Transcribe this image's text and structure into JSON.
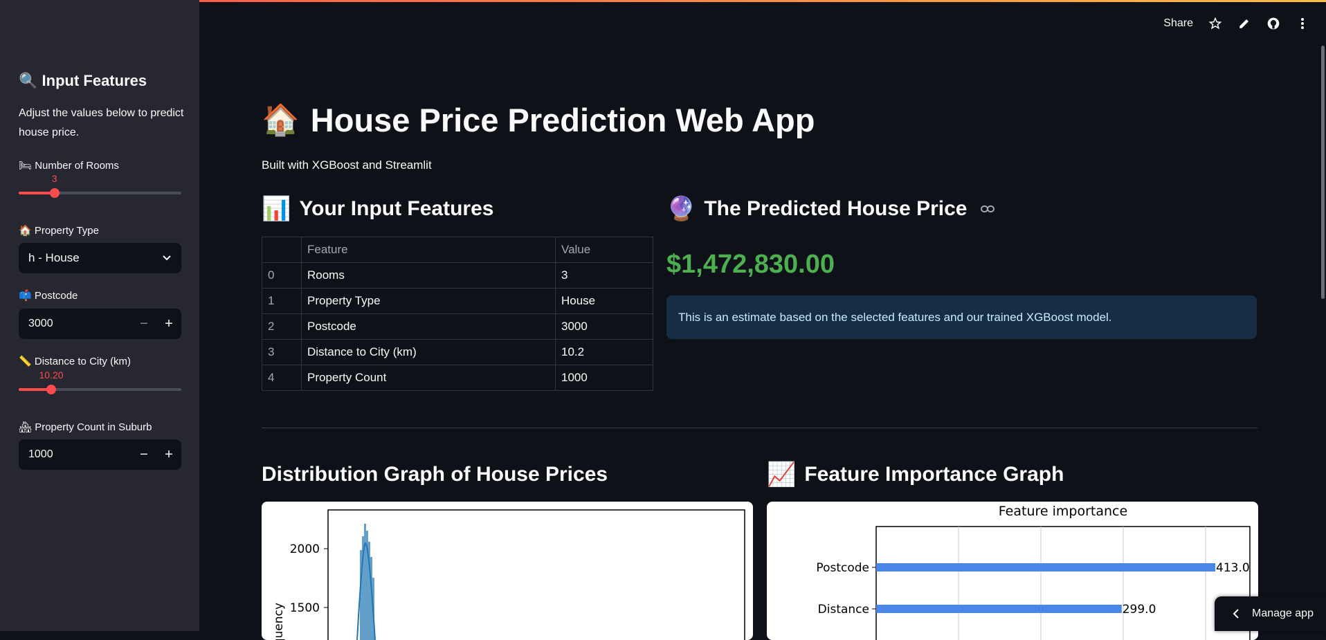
{
  "toolbar": {
    "share_label": "Share",
    "icons": [
      "star-icon",
      "edit-icon",
      "github-icon",
      "more-icon"
    ]
  },
  "sidebar": {
    "title": "Input Features",
    "title_icon": "magnifier-icon",
    "description": "Adjust the values below to predict house price.",
    "rooms": {
      "label": "Number of Rooms",
      "icon": "bed-icon",
      "value": "3",
      "fraction": 0.22
    },
    "property_type": {
      "label": "Property Type",
      "icon": "house-icon",
      "value": "h - House"
    },
    "postcode": {
      "label": "Postcode",
      "icon": "mailbox-icon",
      "value": "3000",
      "minus": "−",
      "plus": "+"
    },
    "distance": {
      "label": "Distance to City (km)",
      "icon": "ruler-icon",
      "value": "10.20",
      "fraction": 0.2
    },
    "property_count": {
      "label": "Property Count in Suburb",
      "icon": "houses-icon",
      "value": "1000",
      "minus": "−",
      "plus": "+"
    }
  },
  "main": {
    "title": "House Price Prediction Web App",
    "subtitle": "Built with XGBoost and Streamlit",
    "input_heading": "Your Input Features",
    "table": {
      "headers": [
        "",
        "Feature",
        "Value"
      ],
      "rows": [
        [
          "0",
          "Rooms",
          "3"
        ],
        [
          "1",
          "Property Type",
          "House"
        ],
        [
          "2",
          "Postcode",
          "3000"
        ],
        [
          "3",
          "Distance to City (km)",
          "10.2"
        ],
        [
          "4",
          "Property Count",
          "1000"
        ]
      ]
    },
    "predicted_heading": "The Predicted House Price",
    "price": "$1,472,830.00",
    "info": "This is an estimate based on the selected features and our trained XGBoost model.",
    "dist_heading": "Distribution Graph of House Prices",
    "fi_heading": "Feature Importance Graph",
    "manage_label": "Manage app"
  },
  "chart_data": [
    {
      "type": "bar",
      "title": "",
      "xlabel": "",
      "ylabel": "Frequency",
      "y_ticks": [
        "2000",
        "1500"
      ],
      "note": "histogram of house prices, tall narrow peak near left"
    },
    {
      "type": "bar",
      "title": "Feature importance",
      "categories": [
        "Postcode",
        "Distance"
      ],
      "values": [
        413.0,
        299.0
      ],
      "value_labels": [
        "413.0",
        "299.0"
      ],
      "color": "#4a86e8"
    }
  ]
}
